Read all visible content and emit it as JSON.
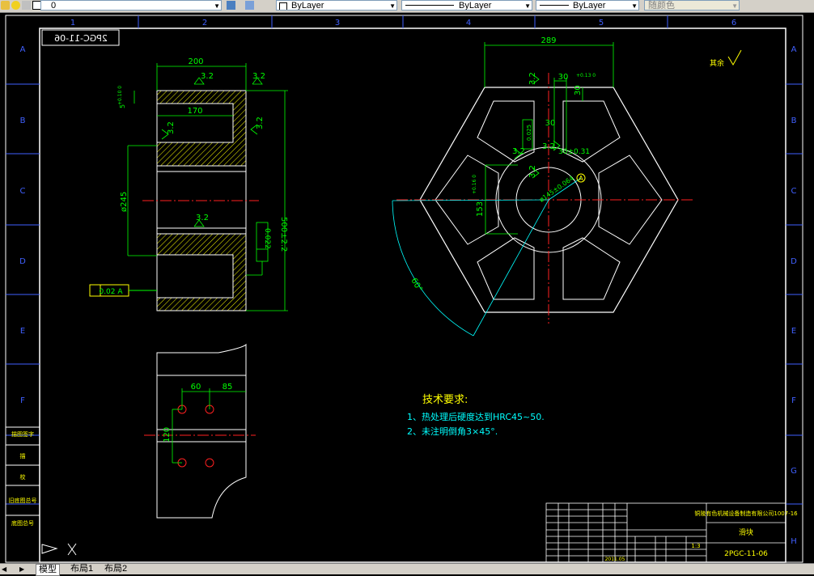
{
  "toolbar": {
    "layer_value": "0",
    "color_value": "ByLayer",
    "linetype_value": "ByLayer",
    "lineweight_value": "ByLayer",
    "plotstyle_value": "随颜色"
  },
  "grid": {
    "columns": [
      "1",
      "2",
      "3",
      "4",
      "5",
      "6"
    ],
    "rows": [
      "A",
      "B",
      "C",
      "D",
      "E",
      "F",
      "G",
      "H"
    ]
  },
  "drawing": {
    "mirrored_code": "2PGC-11-06",
    "tech_title": "技术要求:",
    "tech_items": [
      "1、热处理后硬度达到HRC45~50.",
      "2、未注明倒角3×45°."
    ],
    "roughness_corner": "其余",
    "dims": {
      "width_200": "200",
      "r_3_2": "3.2",
      "d_170": "170",
      "d_5": "5",
      "d_5_tol": "+0.10 0",
      "d_245": "ø245",
      "d_500": "500±2.2",
      "tol_022": "0.022",
      "tol_022_ref": "0.02  A",
      "d_289": "289",
      "d_30": "30",
      "d_30_tol": "+0.13 0",
      "d_153": "153",
      "d_153_tol": "+0.16 0",
      "d_3031": "30±0.31",
      "d_ring": "ø145±0.064",
      "d_angle": "60°",
      "d_60": "60",
      "d_85": "85",
      "d_120": "120",
      "datum": "A",
      "tol_box": "0.025"
    }
  },
  "title_block": {
    "company": "铜陵有色机械设备制造有限公司1007-16",
    "part_name": "滑块",
    "drawing_no": "2PGC-11-06",
    "scale": "1:3",
    "date": "2011.05",
    "left_labels": [
      "描图签字",
      "描",
      "校",
      "旧底图总号",
      "底图总号"
    ]
  },
  "statusbar": {
    "tabs": [
      "模型",
      "布局1",
      "布局2"
    ]
  }
}
